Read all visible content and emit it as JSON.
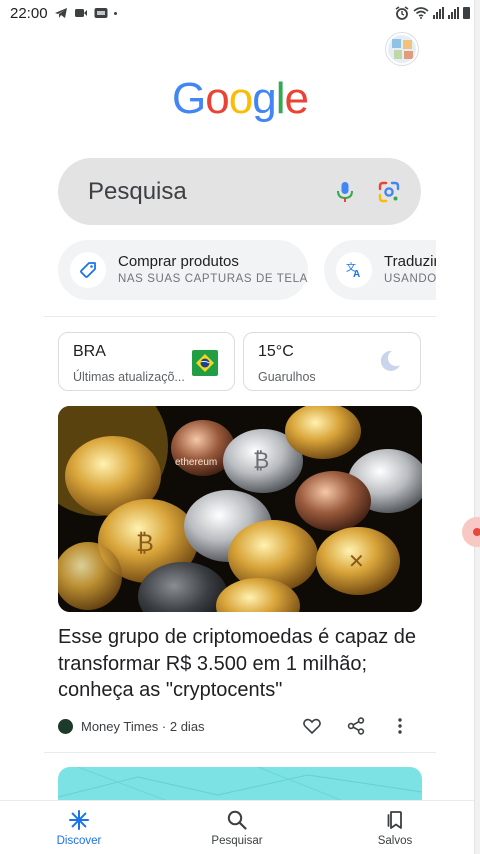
{
  "status_bar": {
    "time": "22:00",
    "dot": "·"
  },
  "colors": {
    "google_blue": "#4285F4",
    "google_red": "#EA4335",
    "google_yellow": "#FBBC05",
    "google_green": "#34A853",
    "active_nav": "#1a73e8"
  },
  "logo": {
    "letters": [
      "G",
      "o",
      "o",
      "g",
      "l",
      "e"
    ]
  },
  "search": {
    "placeholder": "Pesquisa",
    "icons": [
      "mic-icon",
      "lens-icon"
    ]
  },
  "chips": [
    {
      "title": "Comprar produtos",
      "subtitle": "NAS SUAS CAPTURAS DE TELA",
      "icon": "tag-icon"
    },
    {
      "title": "Traduzir",
      "subtitle": "USANDO",
      "icon": "translate-icon"
    }
  ],
  "info_cards": {
    "market": {
      "title": "BRA",
      "subtitle": "Últimas atualizaçõ...",
      "icon": "brazil-flag-icon"
    },
    "weather": {
      "title": "15°C",
      "subtitle": "Guarulhos",
      "icon": "moon-icon"
    }
  },
  "article": {
    "headline": "Esse grupo de criptomoedas é capaz de transformar R$ 3.500 em 1 milhão; conheça as \"cryptocents\"",
    "source": "Money Times · 2 dias",
    "image_text": "ethereum",
    "actions": [
      "heart-icon",
      "share-icon",
      "more-icon"
    ]
  },
  "bottom_nav": [
    {
      "label": "Discover",
      "icon": "discover-icon",
      "active": true
    },
    {
      "label": "Pesquisar",
      "icon": "search-icon",
      "active": false
    },
    {
      "label": "Salvos",
      "icon": "bookmarks-icon",
      "active": false
    }
  ]
}
